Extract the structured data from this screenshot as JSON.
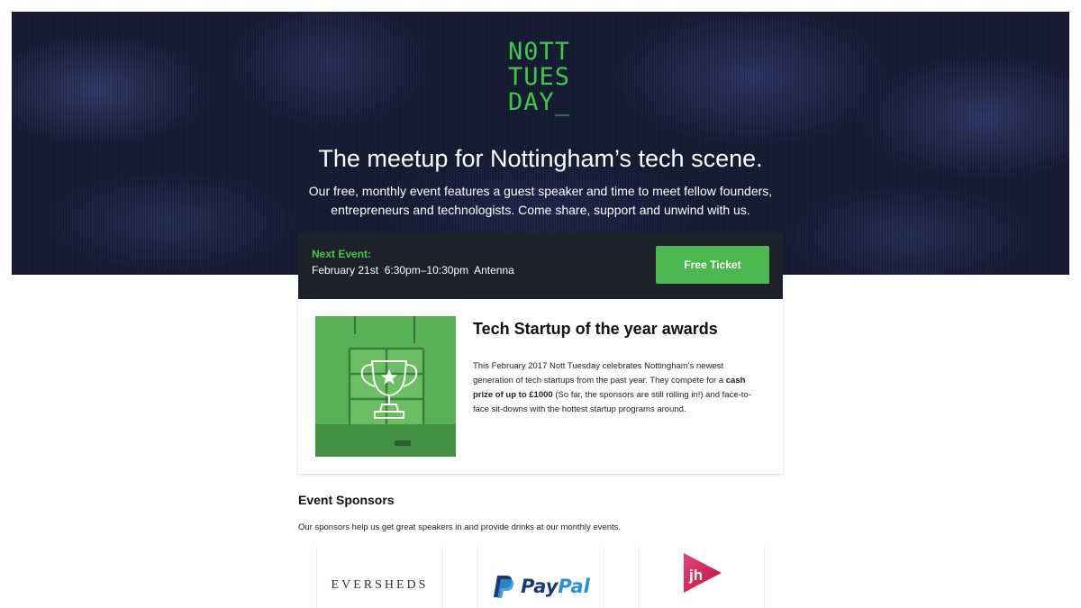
{
  "hero": {
    "logo_lines": [
      "N0TT",
      "TUES",
      "DAY_"
    ],
    "headline": "The meetup for Nottingham’s tech scene.",
    "subline": "Our free, monthly event features a guest speaker and time to meet fellow founders, entrepreneurs and technologists. Come share, support and unwind with us."
  },
  "next_event": {
    "label": "Next Event:",
    "details": "February 21st  6:30pm–10:30pm  Antenna",
    "ticket_button": "Free Ticket"
  },
  "award": {
    "title": "Tech Startup of the year awards",
    "text_before": "This February 2017 Nott Tuesday celebrates Nottingham’s newest generation of tech startups from the past year. They compete for a ",
    "text_bold": "cash prize of up to £1000",
    "text_after": " (So far, the sponsors are still rolling in!) and face-to-face sit-downs with the hottest startup programs around.",
    "image_icon": "trophy-icon"
  },
  "sponsors": {
    "title": "Event Sponsors",
    "description": "Our sponsors help us get great speakers in and provide drinks at our monthly events.",
    "items": [
      {
        "name": "EVERSHEDS"
      },
      {
        "name_a": "Pay",
        "name_b": "Pal"
      },
      {
        "name": "jh"
      }
    ]
  },
  "colors": {
    "brand_green": "#3fc84a",
    "button_green": "#4cb84f",
    "bar_dark": "#1d2129",
    "hero_navy": "#181d36"
  }
}
